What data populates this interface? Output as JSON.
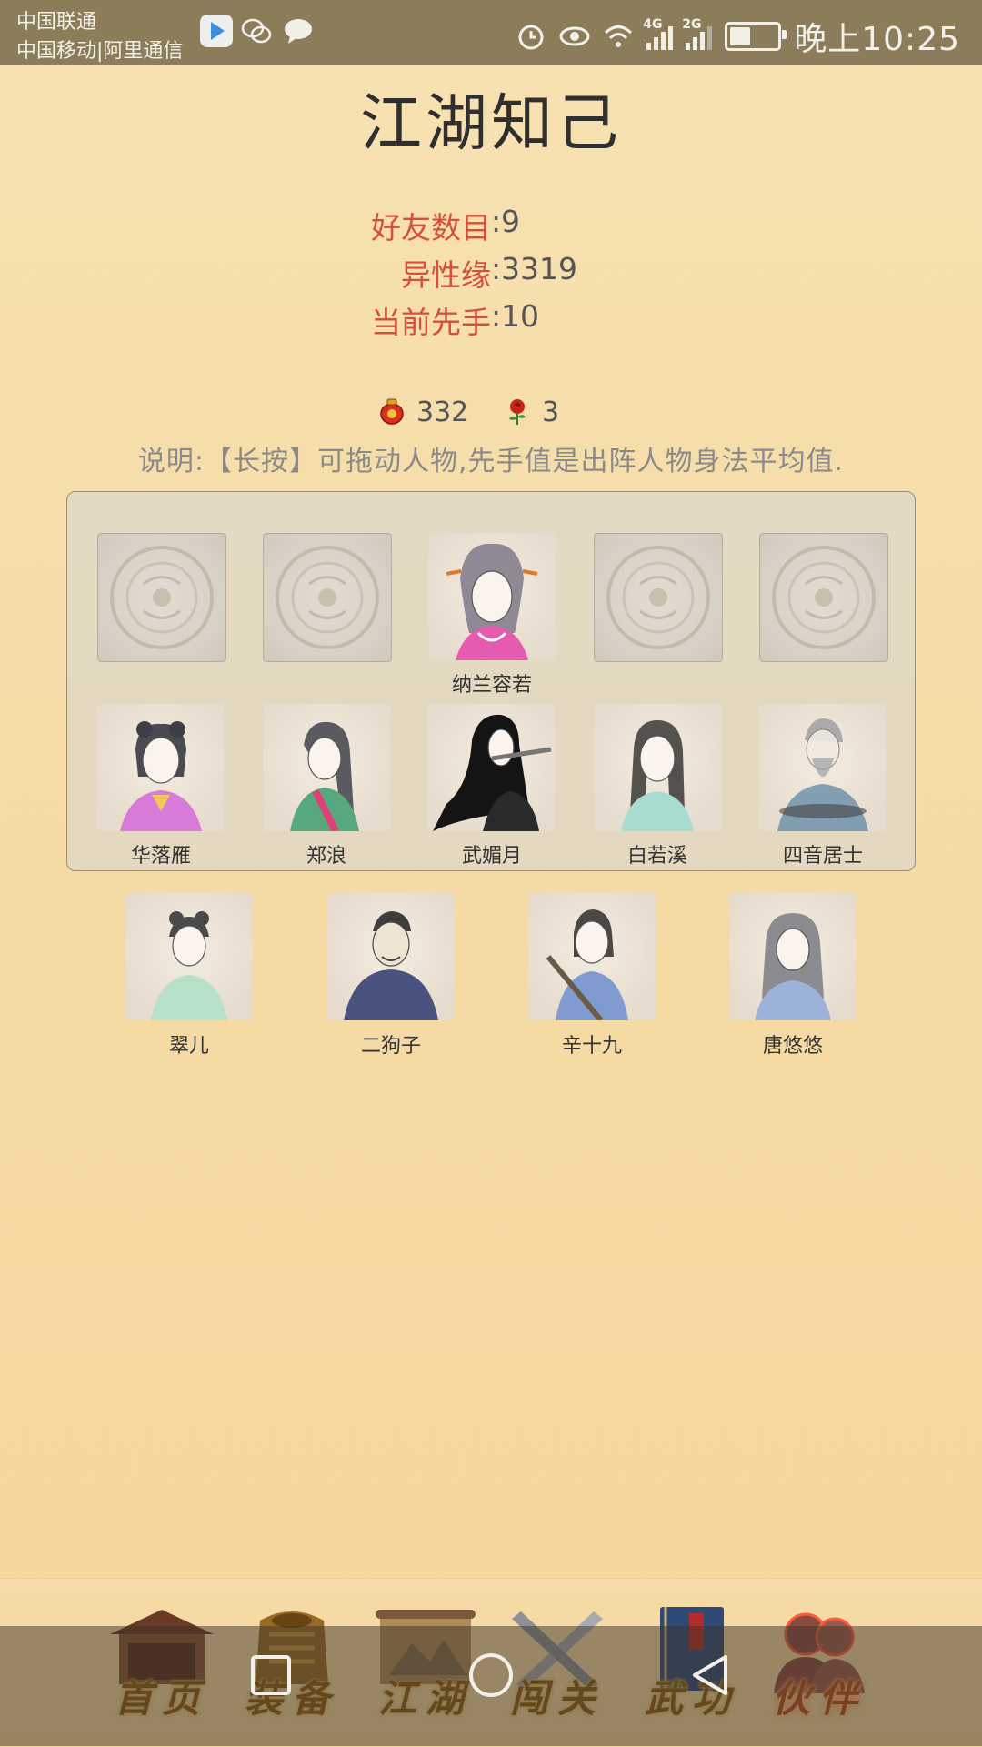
{
  "status_bar": {
    "carrier1": "中国联通",
    "carrier2": "中国移动|阿里通信",
    "network_4g": "4G",
    "network_2g": "2G",
    "time": "晚上10:25",
    "battery_level": 0.5
  },
  "page": {
    "title": "江湖知己"
  },
  "stats": [
    {
      "label": "好友数目",
      "value": "9"
    },
    {
      "label": "异性缘",
      "value": "3319"
    },
    {
      "label": "当前先手",
      "value": "10"
    }
  ],
  "stat_colon": ":",
  "currency": {
    "wine": "332",
    "rose": "3"
  },
  "description": "说明:【长按】可拖动人物,先手值是出阵人物身法平均值.",
  "formation": {
    "slots": [
      "",
      "",
      "纳兰容若",
      "",
      ""
    ],
    "row2": [
      "华落雁",
      "郑浪",
      "武媚月",
      "白若溪",
      "四音居士"
    ]
  },
  "reserve": [
    "翠儿",
    "二狗子",
    "辛十九",
    "唐悠悠"
  ],
  "nav": [
    {
      "label": "首页",
      "icon": "house-icon"
    },
    {
      "label": "装备",
      "icon": "armor-icon"
    },
    {
      "label": "江湖",
      "icon": "scroll-icon"
    },
    {
      "label": "闯关",
      "icon": "swords-icon"
    },
    {
      "label": "武功",
      "icon": "book-icon"
    },
    {
      "label": "伙伴",
      "icon": "partners-icon"
    }
  ],
  "colors": {
    "accent_label": "#d4503a",
    "status_bar": "#8b7d5a",
    "background": "#f6dba6"
  }
}
